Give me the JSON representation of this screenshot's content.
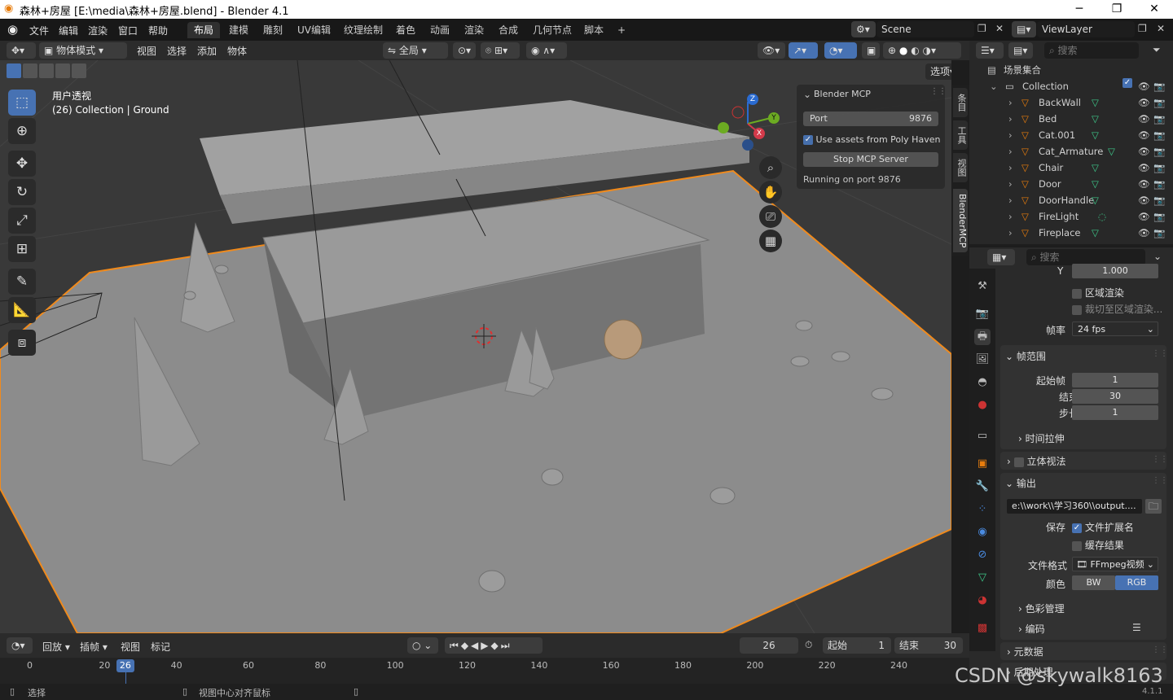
{
  "window": {
    "title": "森林+房屋 [E:\\media\\森林+房屋.blend] - Blender 4.1",
    "minimize": "─",
    "restore": "❐",
    "close": "✕"
  },
  "menu": [
    "文件",
    "编辑",
    "渲染",
    "窗口",
    "帮助"
  ],
  "workspaces": [
    "布局",
    "建模",
    "雕刻",
    "UV编辑",
    "纹理绘制",
    "着色",
    "动画",
    "渲染",
    "合成",
    "几何节点",
    "脚本",
    "+"
  ],
  "scene": {
    "name": "Scene",
    "view_layer": "ViewLayer"
  },
  "viewport_header": {
    "mode": "物体模式",
    "menus": [
      "视图",
      "选择",
      "添加",
      "物体"
    ],
    "transform": "全局",
    "options": "选项"
  },
  "viewport": {
    "view_name": "用户透视",
    "collection_info": "(26) Collection | Ground"
  },
  "gizmo": {
    "x": "X",
    "y": "Y",
    "z": "Z"
  },
  "mcp_panel": {
    "title": "Blender MCP",
    "port_label": "Port",
    "port_value": "9876",
    "use_assets_label": "Use assets from Poly Haven",
    "stop_button": "Stop MCP Server",
    "status": "Running on port 9876"
  },
  "n_tabs": [
    "条目",
    "工具",
    "视图",
    "BlenderMCP"
  ],
  "outliner": {
    "search_placeholder": "搜索",
    "scene_collection": "场景集合",
    "collection": "Collection",
    "items": [
      "BackWall",
      "Bed",
      "Cat.001",
      "Cat_Armature",
      "Chair",
      "Door",
      "DoorHandle",
      "FireLight",
      "Fireplace"
    ]
  },
  "properties": {
    "search_placeholder": "搜索",
    "y_label": "Y",
    "y_value": "1.000",
    "region_render": "区域渲染",
    "crop_region": "裁切至区域渲染...",
    "frame_rate_label": "帧率",
    "frame_rate": "24 fps",
    "frame_range_title": "帧范围",
    "start_label": "起始帧",
    "start_value": "1",
    "end_label": "结束",
    "end_value": "30",
    "step_label": "步长",
    "step_value": "1",
    "time_stretch": "时间拉伸",
    "stereoscopy": "立体视法",
    "output_title": "输出",
    "output_path": "e:\\\\work\\\\学习360\\\\output....",
    "save_label": "保存",
    "file_ext": "文件扩展名",
    "cache_result": "缓存结果",
    "file_format_label": "文件格式",
    "file_format": "FFmpeg视频",
    "color_label": "颜色",
    "bw": "BW",
    "rgb": "RGB",
    "color_management": "色彩管理",
    "encoding": "编码",
    "metadata": "元数据",
    "post_processing": "后期处理"
  },
  "timeline": {
    "playback": "回放",
    "keying": "插帧",
    "view": "视图",
    "marker": "标记",
    "current_frame": "26",
    "start_label": "起始",
    "start": "1",
    "end_label": "结束",
    "end": "30",
    "ruler": [
      "0",
      "20",
      "40",
      "60",
      "80",
      "100",
      "120",
      "140",
      "160",
      "180",
      "200",
      "220",
      "240"
    ],
    "ruler_frames": [
      0,
      20,
      40,
      60,
      80,
      100,
      120,
      140,
      160,
      180,
      200,
      220,
      240
    ]
  },
  "statusbar": {
    "select": "选择",
    "center_view": "视图中心对齐鼠标",
    "version": "4.1.1",
    "watermark": "CSDN @skywalk8163"
  }
}
